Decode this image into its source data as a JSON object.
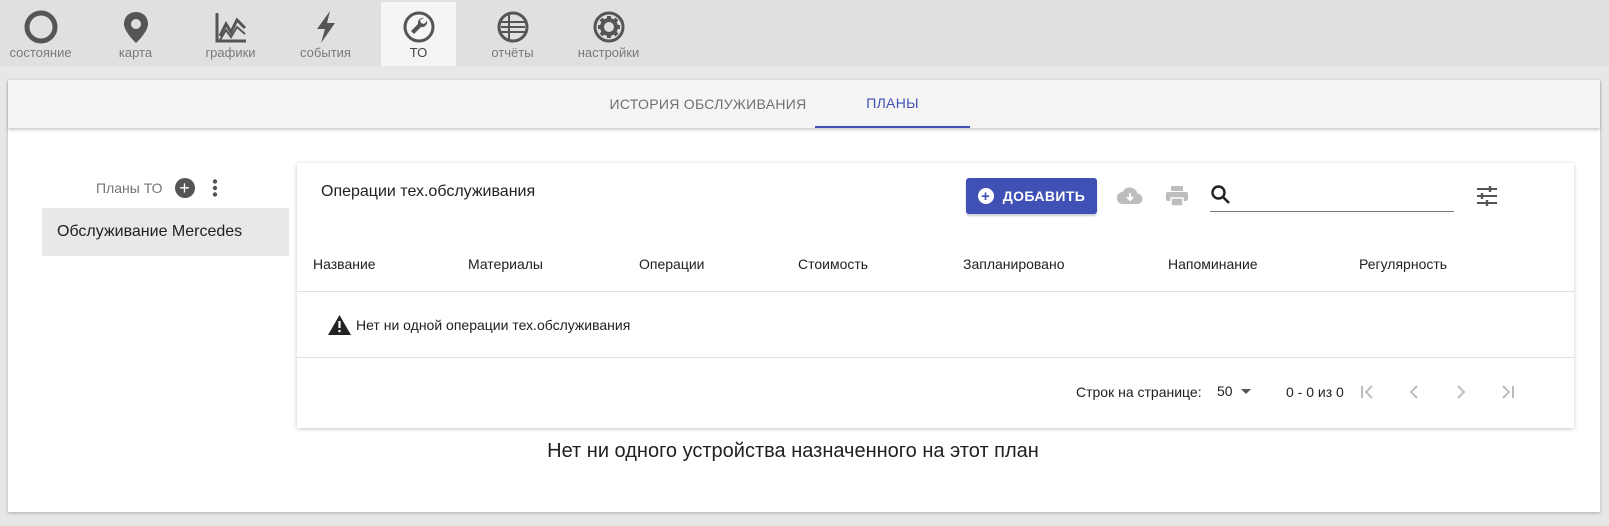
{
  "nav": {
    "tabs": [
      {
        "label": "состояние",
        "icon": "status-circle-icon"
      },
      {
        "label": "карта",
        "icon": "map-pin-icon"
      },
      {
        "label": "графики",
        "icon": "chart-icon"
      },
      {
        "label": "события",
        "icon": "lightning-icon"
      },
      {
        "label": "ТО",
        "icon": "wrench-icon",
        "active": true
      },
      {
        "label": "отчёты",
        "icon": "report-icon"
      },
      {
        "label": "настройки",
        "icon": "gear-icon"
      }
    ]
  },
  "subtabs": {
    "history": "ИСТОРИЯ ОБСЛУЖИВАНИЯ",
    "plans": "ПЛАНЫ",
    "active": "plans"
  },
  "sidebar": {
    "title": "Планы ТО",
    "items": [
      {
        "label": "Обслуживание Mercedes"
      }
    ]
  },
  "table": {
    "title": "Операции тех.обслуживания",
    "add_label": "ДОБАВИТЬ",
    "search_placeholder": "",
    "columns": [
      "Название",
      "Материалы",
      "Операции",
      "Стоимость",
      "Запланировано",
      "Напоминание",
      "Регулярность"
    ],
    "empty_message": "Нет ни одной операции тех.обслуживания",
    "pagination": {
      "rows_per_page_label": "Строк на странице:",
      "rows_per_page": "50",
      "range": "0 - 0 из 0"
    }
  },
  "no_devices_message": "Нет ни одного устройства назначенного на этот план",
  "colors": {
    "accent": "#3f51b5",
    "icon_dark": "#555555",
    "icon_disabled": "#bdbdbd"
  }
}
